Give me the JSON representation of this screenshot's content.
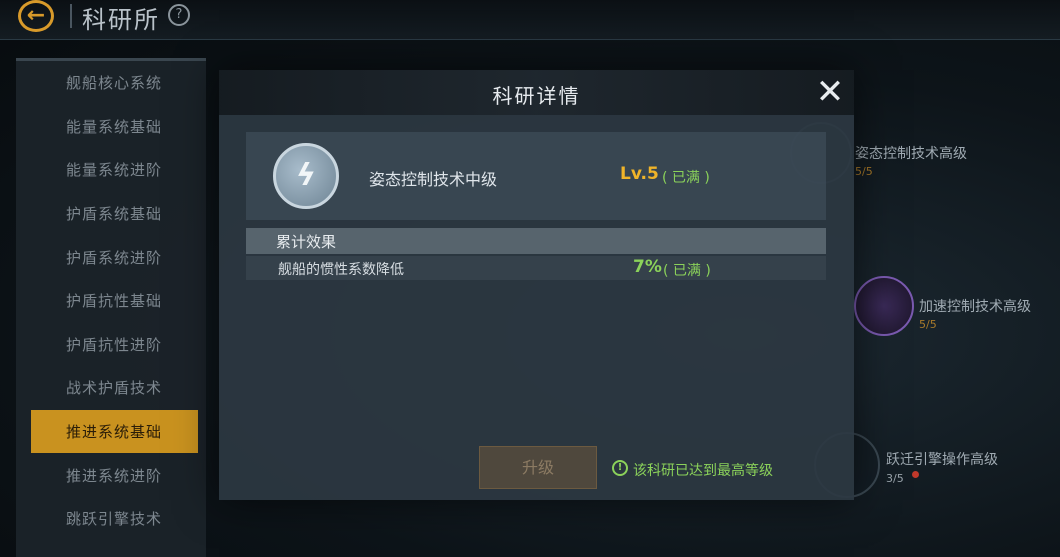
{
  "topbar": {
    "title": "科研所",
    "help_glyph": "?",
    "back_glyph": "←"
  },
  "sidebar": {
    "items": [
      {
        "label": "舰船核心系统",
        "active": false
      },
      {
        "label": "能量系统基础",
        "active": false
      },
      {
        "label": "能量系统进阶",
        "active": false
      },
      {
        "label": "护盾系统基础",
        "active": false
      },
      {
        "label": "护盾系统进阶",
        "active": false
      },
      {
        "label": "护盾抗性基础",
        "active": false
      },
      {
        "label": "护盾抗性进阶",
        "active": false
      },
      {
        "label": "战术护盾技术",
        "active": false
      },
      {
        "label": "推进系统基础",
        "active": true
      },
      {
        "label": "推进系统进阶",
        "active": false
      },
      {
        "label": "跳跃引擎技术",
        "active": false
      }
    ]
  },
  "tree": {
    "nodes": [
      {
        "label": "姿态控制技术高级",
        "count": "5/5"
      },
      {
        "label": "加速控制技术高级",
        "count": "5/5"
      },
      {
        "label": "跃迁引擎操作高级",
        "count": "3/5"
      }
    ]
  },
  "modal": {
    "title": "科研详情",
    "close_glyph": "✕",
    "tech": {
      "name": "姿态控制技术中级",
      "level": "Lv.5",
      "level_status": "( 已满 )",
      "icon": "lightning-bolt-icon"
    },
    "effect_header": "累计效果",
    "effects": [
      {
        "name": "舰船的惯性系数降低",
        "value": "7%",
        "status": "( 已满 )"
      }
    ],
    "upgrade_label": "升级",
    "max_notice": "该科研已达到最高等级",
    "notice_glyph": "!"
  },
  "colors": {
    "accent_gold": "#c9921f",
    "level_orange": "#f0b429",
    "maxed_green": "#8bd25a"
  }
}
